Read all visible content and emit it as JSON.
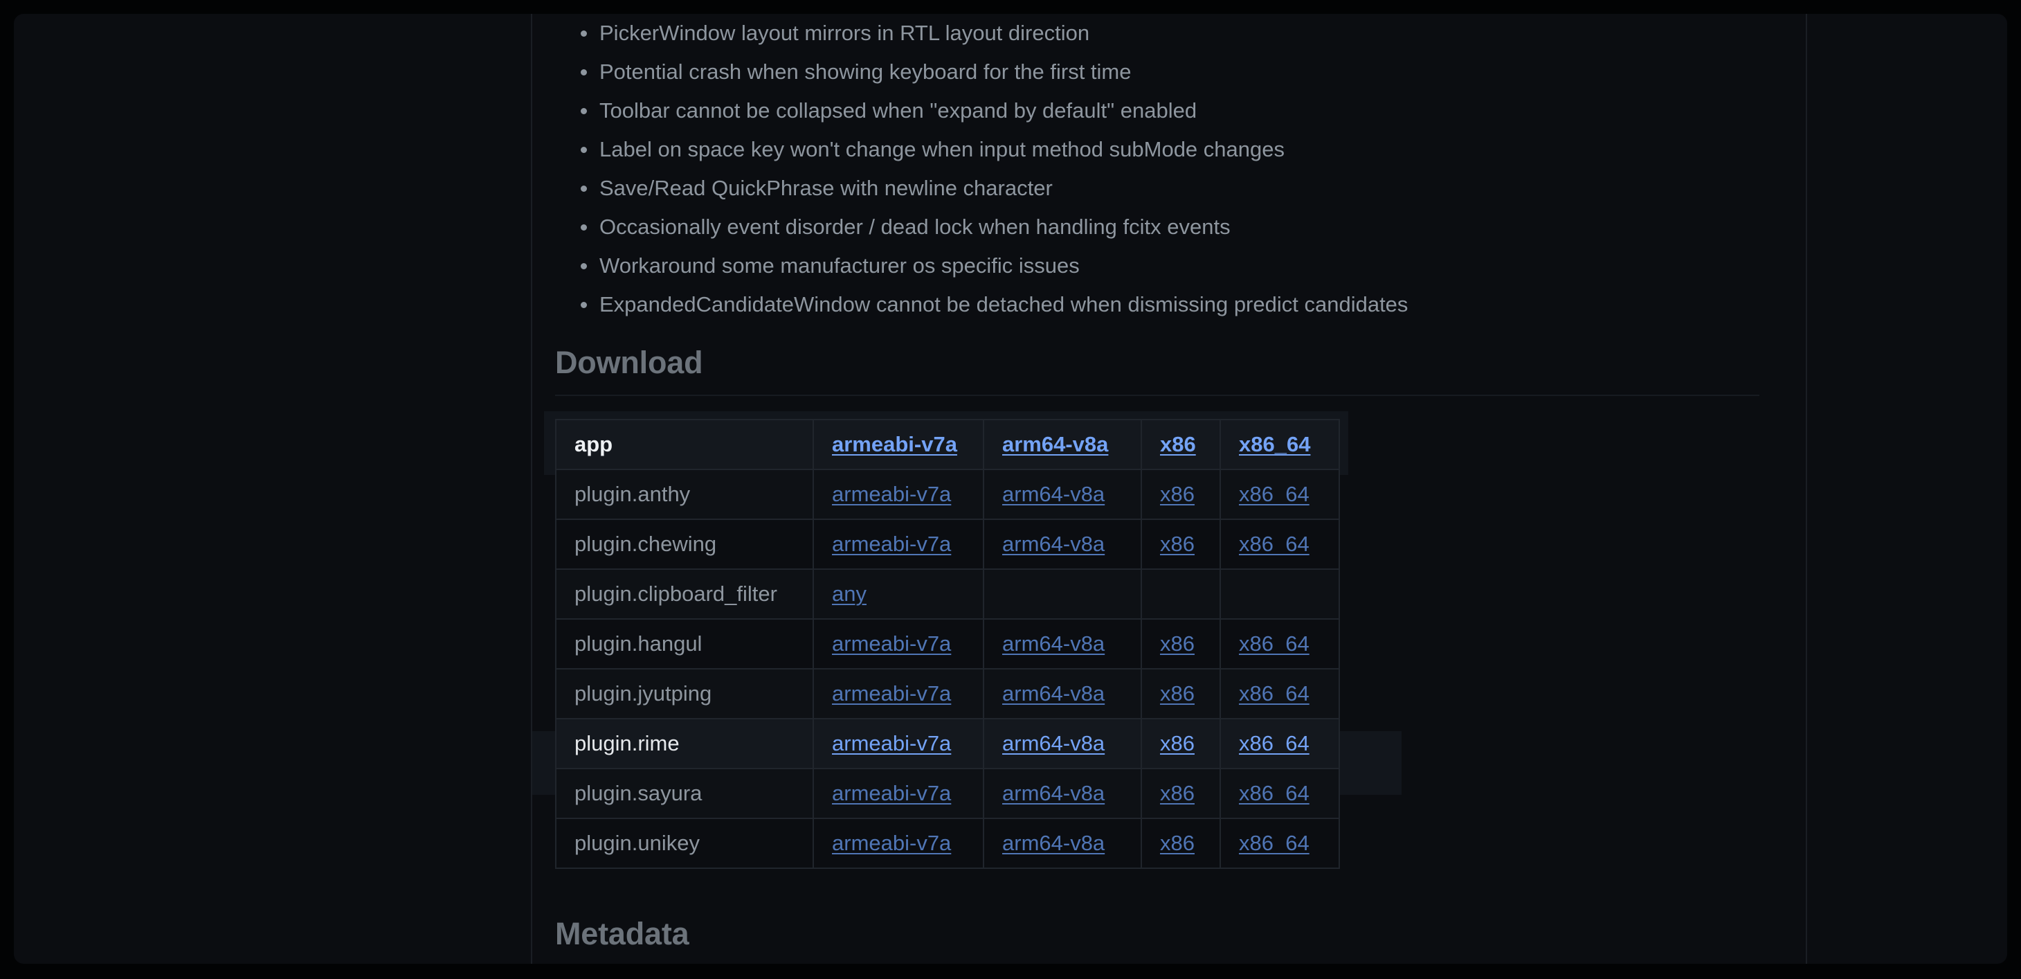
{
  "fixes": [
    "PickerWindow layout mirrors in RTL layout direction",
    "Potential crash when showing keyboard for the first time",
    "Toolbar cannot be collapsed when \"expand by default\" enabled",
    "Label on space key won't change when input method subMode changes",
    "Save/Read QuickPhrase with newline character",
    "Occasionally event disorder / dead lock when handling fcitx events",
    "Workaround some manufacturer os specific issues",
    "ExpandedCandidateWindow cannot be detached when dismissing predict candidates"
  ],
  "download": {
    "heading": "Download",
    "rows": [
      {
        "name": "app",
        "links": [
          "armeabi-v7a",
          "arm64-v8a",
          "x86",
          "x86_64"
        ]
      },
      {
        "name": "plugin.anthy",
        "links": [
          "armeabi-v7a",
          "arm64-v8a",
          "x86",
          "x86_64"
        ]
      },
      {
        "name": "plugin.chewing",
        "links": [
          "armeabi-v7a",
          "arm64-v8a",
          "x86",
          "x86_64"
        ]
      },
      {
        "name": "plugin.clipboard_filter",
        "links": [
          "any",
          "",
          "",
          ""
        ]
      },
      {
        "name": "plugin.hangul",
        "links": [
          "armeabi-v7a",
          "arm64-v8a",
          "x86",
          "x86_64"
        ]
      },
      {
        "name": "plugin.jyutping",
        "links": [
          "armeabi-v7a",
          "arm64-v8a",
          "x86",
          "x86_64"
        ]
      },
      {
        "name": "plugin.rime",
        "links": [
          "armeabi-v7a",
          "arm64-v8a",
          "x86",
          "x86_64"
        ]
      },
      {
        "name": "plugin.sayura",
        "links": [
          "armeabi-v7a",
          "arm64-v8a",
          "x86",
          "x86_64"
        ]
      },
      {
        "name": "plugin.unikey",
        "links": [
          "armeabi-v7a",
          "arm64-v8a",
          "x86",
          "x86_64"
        ]
      }
    ]
  },
  "metadata": {
    "heading": "Metadata"
  },
  "colors": {
    "link": "#5076b6",
    "link_active": "#74a3f6",
    "text": "#8e969f",
    "background": "#0b0d11"
  }
}
